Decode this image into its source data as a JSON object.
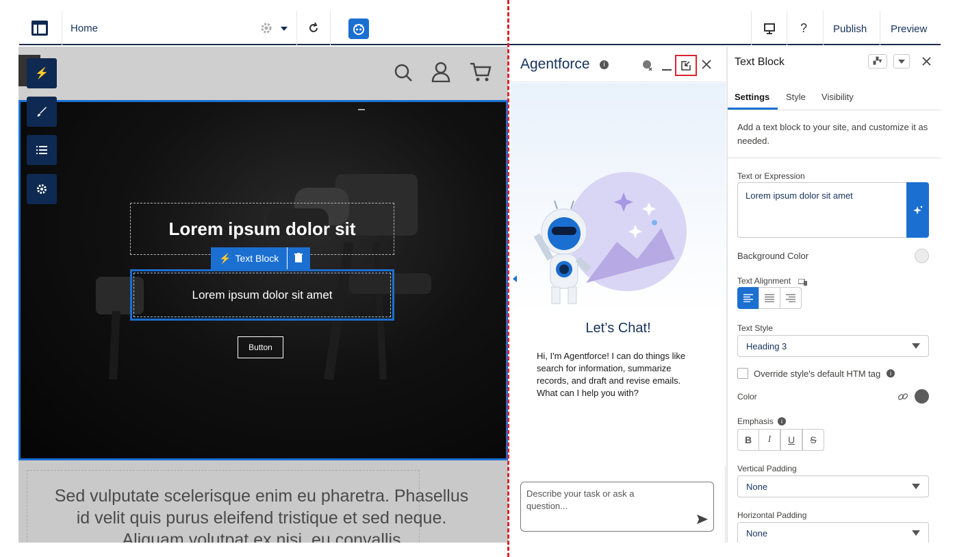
{
  "topbar": {
    "page_label": "Home",
    "publish_label": "Publish",
    "preview_label": "Preview",
    "help_label": "?"
  },
  "canvas": {
    "heading": "Lorem ipsum dolor sit",
    "text_block_tag": "Text Block",
    "body_text": "Lorem ipsum dolor sit amet",
    "button_label": "Button",
    "footer_text": "Sed vulputate scelerisque enim eu pharetra. Phasellus id velit quis purus eleifend tristique et sed neque. Aliquam volutpat ex nisi, eu convallis"
  },
  "agent": {
    "title": "Agentforce",
    "chat_heading": "Let’s Chat!",
    "intro": "Hi, I'm Agentforce! I can do things like search for information, summarize records, and draft and revise emails. What can I help you with?",
    "input_placeholder": "Describe your task or ask a question..."
  },
  "settings": {
    "title": "Text Block",
    "tabs": [
      "Settings",
      "Style",
      "Visibility"
    ],
    "description": "Add a text block to your site, and customize it as needed.",
    "text_expr_label": "Text or Expression",
    "text_expr_value": "Lorem ipsum dolor sit amet",
    "bg_color_label": "Background Color",
    "text_align_label": "Text Alignment",
    "text_style_label": "Text Style",
    "text_style_value": "Heading 3",
    "override_label": "Override style's default HTM tag",
    "color_label": "Color",
    "emphasis_label": "Emphasis",
    "emphasis_buttons": [
      "B",
      "I",
      "U",
      "S"
    ],
    "vpad_label": "Vertical Padding",
    "vpad_value": "None",
    "hpad_label": "Horizontal Padding",
    "hpad_value": "None"
  },
  "colors": {
    "accent": "#1b6fd1",
    "navy": "#0e2a52",
    "divider_red": "#d9232d",
    "text_color_swatch": "#5c5c5c"
  }
}
